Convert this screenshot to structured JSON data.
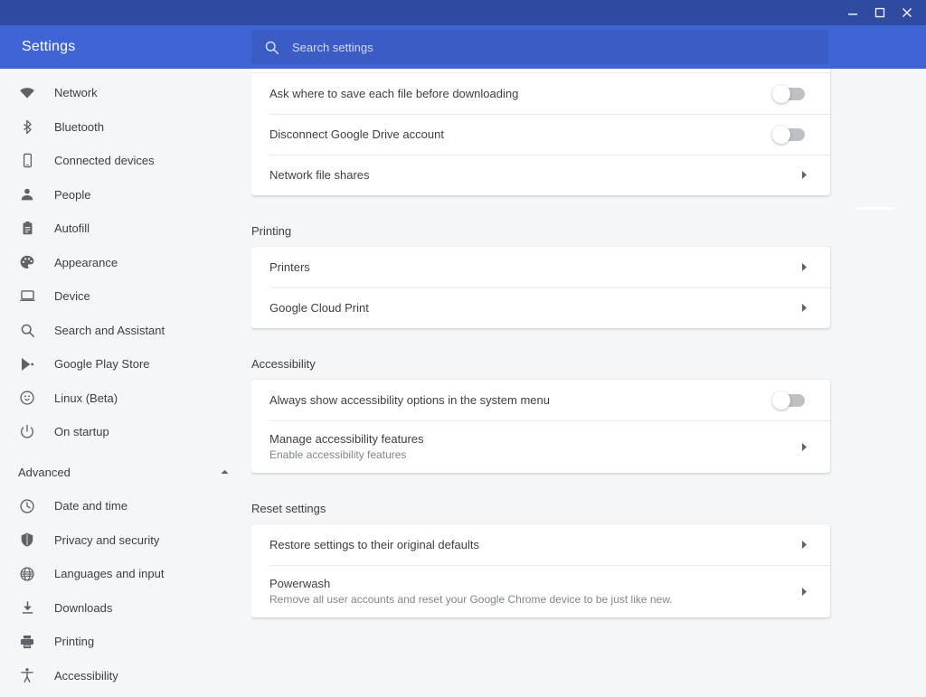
{
  "window": {
    "controls": [
      {
        "name": "minimize",
        "label": "Minimize"
      },
      {
        "name": "maximize",
        "label": "Maximize"
      },
      {
        "name": "close",
        "label": "Close"
      }
    ]
  },
  "header": {
    "title": "Settings",
    "search": {
      "placeholder": "Search settings",
      "value": "",
      "icon": "search-icon"
    },
    "background_color": "#3f65d4",
    "titlebar_color": "#2f4ba0"
  },
  "sidebar": {
    "items": [
      {
        "label": "Network",
        "icon": "wifi-icon"
      },
      {
        "label": "Bluetooth",
        "icon": "bluetooth-icon"
      },
      {
        "label": "Connected devices",
        "icon": "phone-icon"
      },
      {
        "label": "People",
        "icon": "person-icon"
      },
      {
        "label": "Autofill",
        "icon": "clipboard-icon"
      },
      {
        "label": "Appearance",
        "icon": "palette-icon"
      },
      {
        "label": "Device",
        "icon": "laptop-icon"
      },
      {
        "label": "Search and Assistant",
        "icon": "search-icon"
      },
      {
        "label": "Google Play Store",
        "icon": "play-store-icon"
      },
      {
        "label": "Linux (Beta)",
        "icon": "linux-penguin-icon"
      },
      {
        "label": "On startup",
        "icon": "power-icon"
      }
    ],
    "advanced": {
      "label": "Advanced",
      "expanded": true,
      "chevron_icon": "chevron-up-icon"
    },
    "advanced_items": [
      {
        "label": "Date and time",
        "icon": "clock-icon"
      },
      {
        "label": "Privacy and security",
        "icon": "shield-icon"
      },
      {
        "label": "Languages and input",
        "icon": "globe-icon"
      },
      {
        "label": "Downloads",
        "icon": "download-icon"
      },
      {
        "label": "Printing",
        "icon": "printer-icon"
      },
      {
        "label": "Accessibility",
        "icon": "accessibility-icon"
      }
    ]
  },
  "content": {
    "downloads_card": {
      "rows": [
        {
          "label": "Ask where to save each file before downloading",
          "control": "toggle",
          "toggle_on": false
        },
        {
          "label": "Disconnect Google Drive account",
          "control": "toggle",
          "toggle_on": false
        },
        {
          "label": "Network file shares",
          "control": "arrow",
          "arrow_icon": "arrow-right-icon"
        }
      ]
    },
    "printing": {
      "title": "Printing",
      "rows": [
        {
          "label": "Printers",
          "control": "arrow",
          "arrow_icon": "arrow-right-icon"
        },
        {
          "label": "Google Cloud Print",
          "control": "arrow",
          "arrow_icon": "arrow-right-icon"
        }
      ]
    },
    "accessibility": {
      "title": "Accessibility",
      "rows": [
        {
          "label": "Always show accessibility options in the system menu",
          "control": "toggle",
          "toggle_on": false
        },
        {
          "label": "Manage accessibility features",
          "sublabel": "Enable accessibility features",
          "control": "arrow",
          "arrow_icon": "arrow-right-icon"
        }
      ]
    },
    "reset": {
      "title": "Reset settings",
      "rows": [
        {
          "label": "Restore settings to their original defaults",
          "control": "arrow",
          "arrow_icon": "arrow-right-icon"
        },
        {
          "label": "Powerwash",
          "sublabel": "Remove all user accounts and reset your Google Chrome device to be just like new.",
          "control": "arrow",
          "arrow_icon": "arrow-right-icon"
        }
      ]
    }
  }
}
